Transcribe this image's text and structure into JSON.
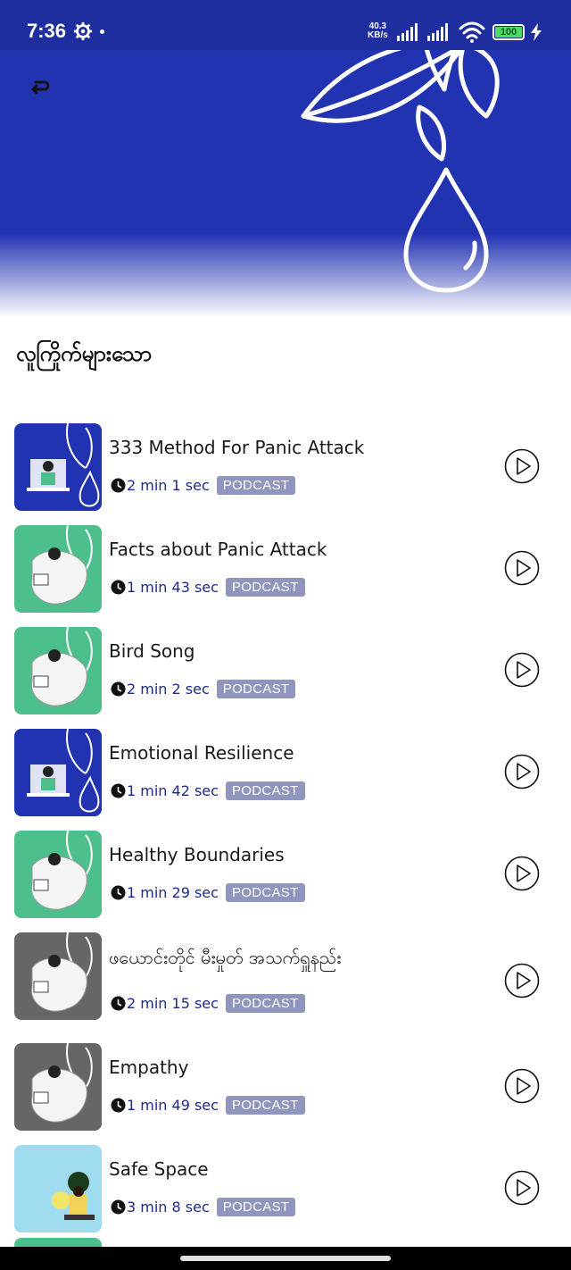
{
  "status_bar": {
    "time": "7:36",
    "net_speed_value": "40.3",
    "net_speed_unit": "KB/s",
    "battery": "100"
  },
  "header": {
    "back_icon": "back-arrow-icon",
    "accent_color": "#2233b2"
  },
  "section": {
    "title": "လူကြိုက်များသော"
  },
  "items": [
    {
      "title": "333 Method For Panic Attack",
      "duration": "2 min 1 sec",
      "badge": "PODCAST",
      "thumb": "blue"
    },
    {
      "title": "Facts about Panic Attack",
      "duration": "1 min 43 sec",
      "badge": "PODCAST",
      "thumb": "green"
    },
    {
      "title": "Bird Song",
      "duration": "2 min 2 sec",
      "badge": "PODCAST",
      "thumb": "green"
    },
    {
      "title": "Emotional Resilience",
      "duration": "1 min 42 sec",
      "badge": "PODCAST",
      "thumb": "blue"
    },
    {
      "title": "Healthy Boundaries",
      "duration": "1 min 29 sec",
      "badge": "PODCAST",
      "thumb": "green"
    },
    {
      "title": "ဖယောင်းတိုင် မီးမှုတ် အသက်ရှူနည်း",
      "duration": "2 min 15 sec",
      "badge": "PODCAST",
      "thumb": "gray"
    },
    {
      "title": "Empathy",
      "duration": "1 min 49 sec",
      "badge": "PODCAST",
      "thumb": "gray"
    },
    {
      "title": "Safe Space",
      "duration": "3 min 8 sec",
      "badge": "PODCAST",
      "thumb": "lightblue"
    }
  ],
  "colors": {
    "blue_thumb": "#2233b2",
    "green_thumb": "#4dbf8c",
    "gray_thumb": "#666666",
    "lightblue_thumb": "#9fdcef",
    "badge_bg": "#8f95bd",
    "duration_text": "#1d2a8c"
  }
}
